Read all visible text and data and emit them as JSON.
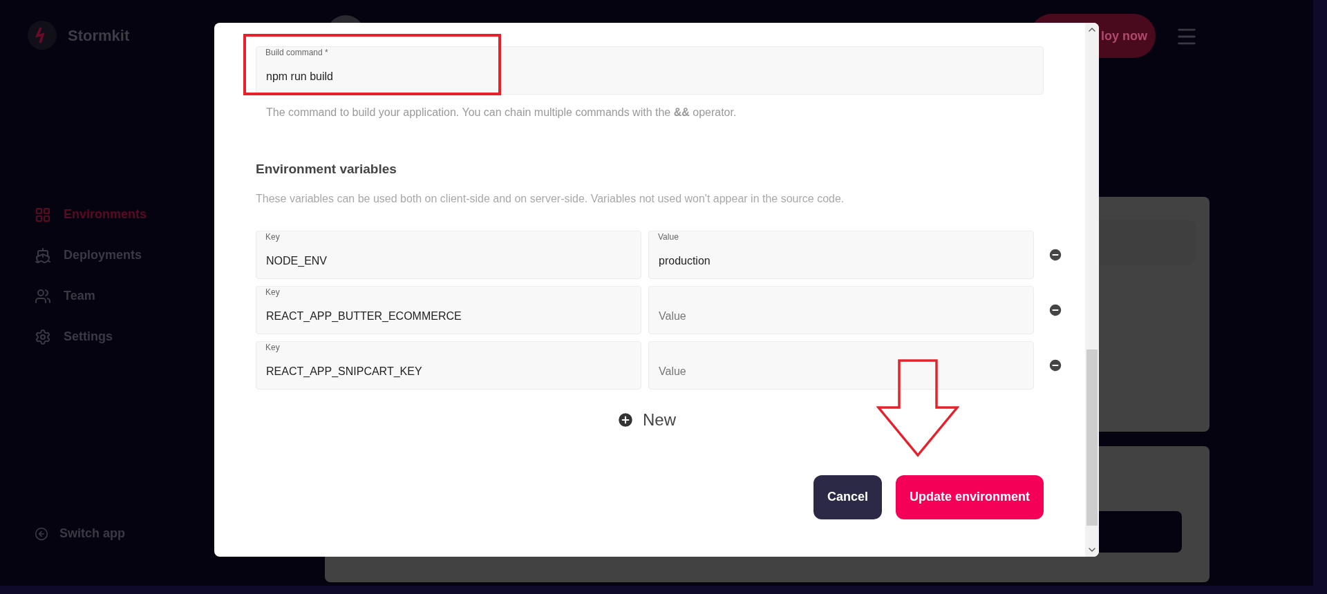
{
  "app": {
    "name": "Stormkit"
  },
  "sidebar": {
    "items": [
      {
        "label": "Environments",
        "selected": true
      },
      {
        "label": "Deployments",
        "selected": false
      },
      {
        "label": "Team",
        "selected": false
      },
      {
        "label": "Settings",
        "selected": false
      }
    ],
    "footer": "Switch app"
  },
  "header": {
    "deploy_button": "loy now"
  },
  "dialog": {
    "build_command": {
      "label": "Build command *",
      "value": "npm run build",
      "help": "The command to build your application. You can chain multiple commands with the **&&** operator."
    },
    "env": {
      "title": "Environment variables",
      "description": "These variables can be used both on client-side and on server-side. Variables not used won't appear in the source code.",
      "rows": [
        {
          "key_label": "Key",
          "key": "NODE_ENV",
          "value_label": "Value",
          "value": "production"
        },
        {
          "key_label": "Key",
          "key": "REACT_APP_BUTTER_ECOMMERCE",
          "value_placeholder": "Value"
        },
        {
          "key_label": "Key",
          "key": "REACT_APP_SNIPCART_KEY",
          "value_placeholder": "Value"
        }
      ]
    },
    "new_button": "New",
    "buttons": [
      {
        "label": "Cancel",
        "kind": "secondary"
      },
      {
        "label": "Update environment",
        "kind": "primary"
      }
    ]
  }
}
